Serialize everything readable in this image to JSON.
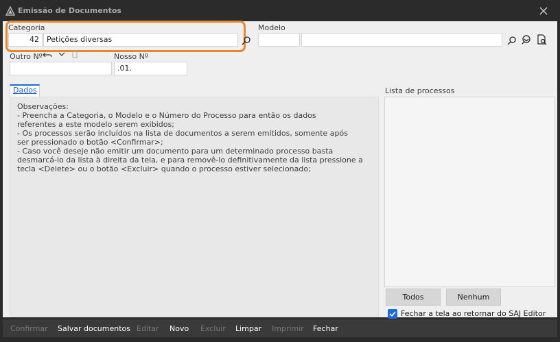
{
  "window": {
    "title": "Emissão de Documentos"
  },
  "categoria": {
    "label": "Categoria",
    "code": "42",
    "name": "Petições diversas"
  },
  "modelo": {
    "label": "Modelo",
    "code": "",
    "name": ""
  },
  "outro_n": {
    "label": "Outro Nº",
    "value": ""
  },
  "nosso_n": {
    "label": "Nosso Nº",
    "value": ".01."
  },
  "tabs": [
    {
      "label": "Dados",
      "active": true
    }
  ],
  "observacoes": [
    "Observações:",
    "  - Preencha a Categoria, o Modelo e o Número do Processo para então os dados",
    "referentes a este modelo serem exibidos;",
    "  - Os processos serão incluídos na lista de documentos a serem emitidos, somente após",
    "ser pressionado o botão <Confirmar>;",
    "  - Caso você deseje não emitir um documento para um determinado processo basta",
    "desmarcá-lo da lista à direita da tela, e para removê-lo definitivamente da lista pressione a",
    "tecla <Delete> ou o botão <Excluir> quando o processo estiver selecionado;"
  ],
  "lista_processos": {
    "label": "Lista de processos",
    "items": []
  },
  "buttons": {
    "todos": "Todos",
    "nenhum": "Nenhum"
  },
  "fechar_checkbox": {
    "label": "Fechar a tela ao retornar do SAJ Editor",
    "checked": true
  },
  "toolbar": {
    "confirmar": "Confirmar",
    "salvar": "Salvar documentos",
    "editar": "Editar",
    "novo": "Novo",
    "excluir": "Excluir",
    "limpar": "Limpar",
    "imprimir": "Imprimir",
    "fechar": "Fechar"
  },
  "colors": {
    "accent": "#1e6ad6",
    "highlight": "#e8862b",
    "titlebar": "#2b2b2b"
  }
}
